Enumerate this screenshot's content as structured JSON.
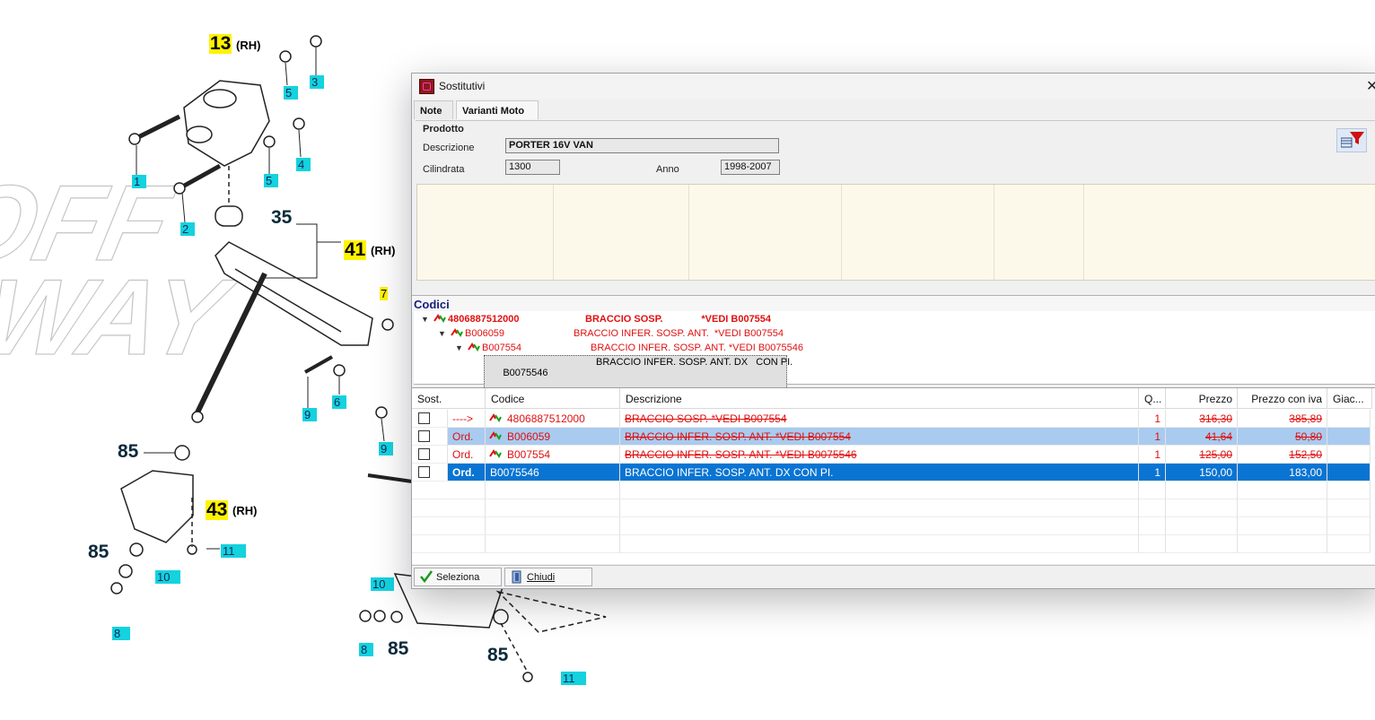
{
  "diagram": {
    "callouts_cyan": [
      "5",
      "3",
      "4",
      "5",
      "1",
      "2",
      "9",
      "6",
      "7",
      "9",
      "11",
      "10",
      "8",
      "10",
      "8",
      "11"
    ],
    "callouts_yellow": [
      "13",
      "41",
      "43",
      "7"
    ],
    "callouts_plain": [
      "35",
      "85",
      "85",
      "85",
      "85"
    ],
    "rh": "(RH)"
  },
  "window": {
    "title": "Sostitutivi",
    "close_glyph": "✕",
    "tabs": [
      "Note",
      "Varianti Moto"
    ],
    "active_tab": 1
  },
  "prodotto": {
    "group_label": "Prodotto",
    "descrizione_label": "Descrizione",
    "descrizione_value": "PORTER 16V VAN",
    "cilindrata_label": "Cilindrata",
    "cilindrata_value": "1300",
    "anno_label": "Anno",
    "anno_value": "1998-2007"
  },
  "codici": {
    "header": "Codici",
    "tree": [
      {
        "code": "4806887512000",
        "desc": "BRACCIO SOSP.              *VEDI B007554",
        "bold": true
      },
      {
        "code": "B006059",
        "desc": "BRACCIO INFER. SOSP. ANT.  *VEDI B007554",
        "bold": false
      },
      {
        "code": "B007554",
        "desc": "BRACCIO INFER. SOSP. ANT. *VEDI B0075546",
        "bold": false
      }
    ],
    "selected": {
      "code": "B0075546",
      "desc": "BRACCIO INFER. SOSP. ANT. DX   CON PI."
    }
  },
  "table": {
    "columns": [
      "Sost.",
      "Codice",
      "Descrizione",
      "Q...",
      "Prezzo",
      "Prezzo con iva",
      "Giac..."
    ],
    "rows": [
      {
        "sost": "---->",
        "codice": "4806887512000",
        "descrizione": "BRACCIO SOSP.              *VEDI B007554",
        "q": "1",
        "prezzo": "316,30",
        "prezzo_iva": "385,89",
        "style": "normal"
      },
      {
        "sost": "Ord.",
        "codice": "B006059",
        "descrizione": "BRACCIO INFER. SOSP. ANT.   *VEDI B007554",
        "q": "1",
        "prezzo": "41,64",
        "prezzo_iva": "50,80",
        "style": "light"
      },
      {
        "sost": "Ord.",
        "codice": "B007554",
        "descrizione": "BRACCIO INFER. SOSP. ANT.  *VEDI B0075546",
        "q": "1",
        "prezzo": "125,00",
        "prezzo_iva": "152,50",
        "style": "normal"
      },
      {
        "sost": "Ord.",
        "codice": "B0075546",
        "descrizione": "BRACCIO INFER. SOSP. ANT. DX   CON PI.",
        "q": "1",
        "prezzo": "150,00",
        "prezzo_iva": "183,00",
        "style": "dark"
      }
    ],
    "empty_rows": 4
  },
  "buttons": {
    "seleziona": "Seleziona",
    "chiudi": "Chiudi"
  },
  "colors": {
    "accent_selected": "#0a74d2",
    "light_selected": "#a9cbef",
    "red_text": "#e01010",
    "callout_cyan": "#14d2de",
    "callout_yellow": "#fff200"
  }
}
